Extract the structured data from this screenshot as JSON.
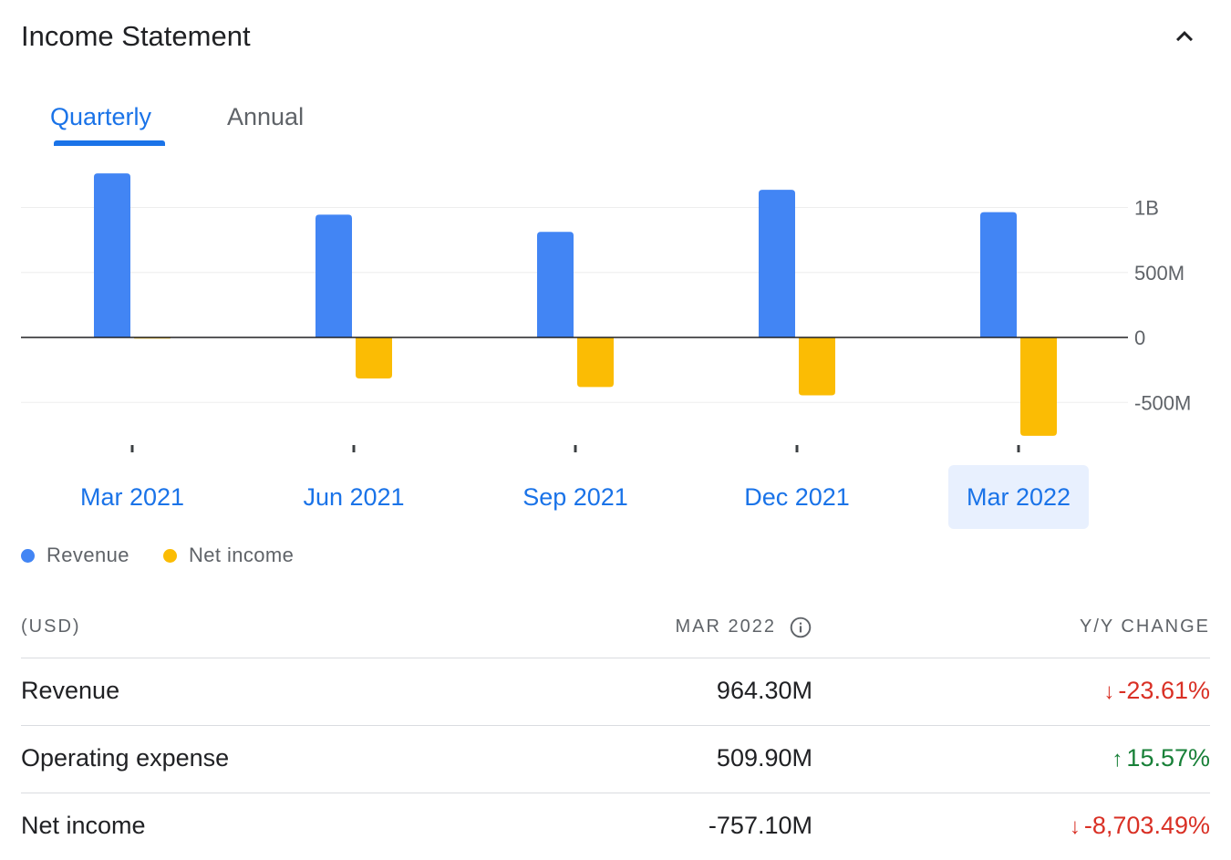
{
  "header": {
    "title": "Income Statement",
    "collapse_icon": "chevron-up-icon"
  },
  "tabs": [
    {
      "label": "Quarterly",
      "active": true
    },
    {
      "label": "Annual",
      "active": false
    }
  ],
  "legend": [
    {
      "label": "Revenue",
      "color": "#4285f4"
    },
    {
      "label": "Net income",
      "color": "#fbbc04"
    }
  ],
  "chart_data": {
    "type": "bar",
    "categories": [
      "Mar 2021",
      "Jun 2021",
      "Sep 2021",
      "Dec 2021",
      "Mar 2022"
    ],
    "selected_category": "Mar 2022",
    "series": [
      {
        "name": "Revenue",
        "color": "#4285f4",
        "values": [
          1262,
          945,
          812,
          1136,
          964.3
        ]
      },
      {
        "name": "Net income",
        "color": "#fbbc04",
        "values": [
          -8.6,
          -316,
          -382,
          -446,
          -757.1
        ]
      }
    ],
    "yticks": [
      {
        "value": 1000,
        "label": "1B"
      },
      {
        "value": 500,
        "label": "500M"
      },
      {
        "value": 0,
        "label": "0"
      },
      {
        "value": -500,
        "label": "-500M"
      }
    ],
    "ylim": [
      -850,
      1320
    ],
    "grid": true,
    "legend_position": "bottom-left"
  },
  "table": {
    "headers": {
      "unit": "(USD)",
      "period": "MAR 2022",
      "change": "Y/Y CHANGE"
    },
    "info_icon": "info-icon",
    "rows": [
      {
        "label": "Revenue",
        "value": "964.30M",
        "change": "-23.61%",
        "direction": "down"
      },
      {
        "label": "Operating expense",
        "value": "509.90M",
        "change": "15.57%",
        "direction": "up"
      },
      {
        "label": "Net income",
        "value": "-757.10M",
        "change": "-8,703.49%",
        "direction": "down"
      }
    ]
  }
}
